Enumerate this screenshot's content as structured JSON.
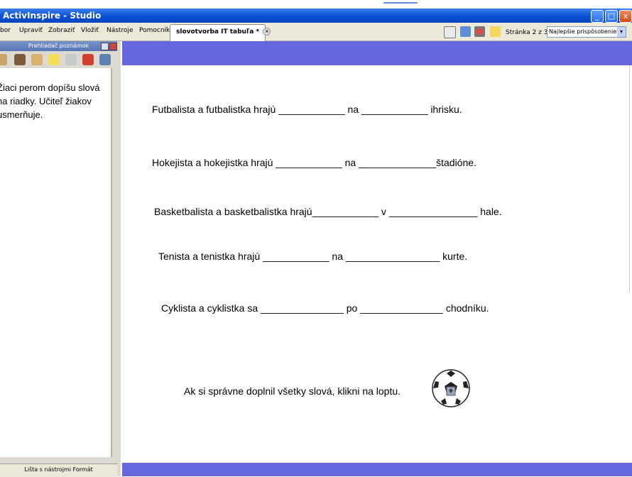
{
  "window": {
    "title": "ActivInspire - Studio",
    "buttons": [
      "_",
      "□",
      "x"
    ]
  },
  "menu": {
    "items": [
      "bor",
      "Upraviť",
      "Zobraziť",
      "Vložiť",
      "Nástroje",
      "Pomocník"
    ],
    "doc_tab": "slovotvorba IT tabuľa *",
    "page_label": "Stránka 2 z 3",
    "zoom": "Najlepšie prispôsobenie"
  },
  "side_panel": {
    "header": "Prehliadač poznámok",
    "note": "Žiaci perom dopíšu slová na riadky. Učiteľ žiakov usmerňuje.",
    "footer": "Lišta s nástrojmi Formát"
  },
  "canvas": {
    "sentences": [
      "Futbalista a futbalistka hrajú ____________ na ____________ ihrisku.",
      "Hokejista a hokejistka hrajú ____________ na ______________štadióne.",
      "Basketbalista a basketbalistka hrajú____________ v ________________ hale.",
      "Tenista a tenistka hrajú ____________ na _________________ kurte.",
      "Cyklista a cyklistka sa _______________ po _______________ chodníku."
    ],
    "instruction": "Ak si správne doplnil všetky slová, klikni na loptu."
  },
  "colors": {
    "accent": "#6666dd",
    "titlebar": "#0a4fd1"
  }
}
